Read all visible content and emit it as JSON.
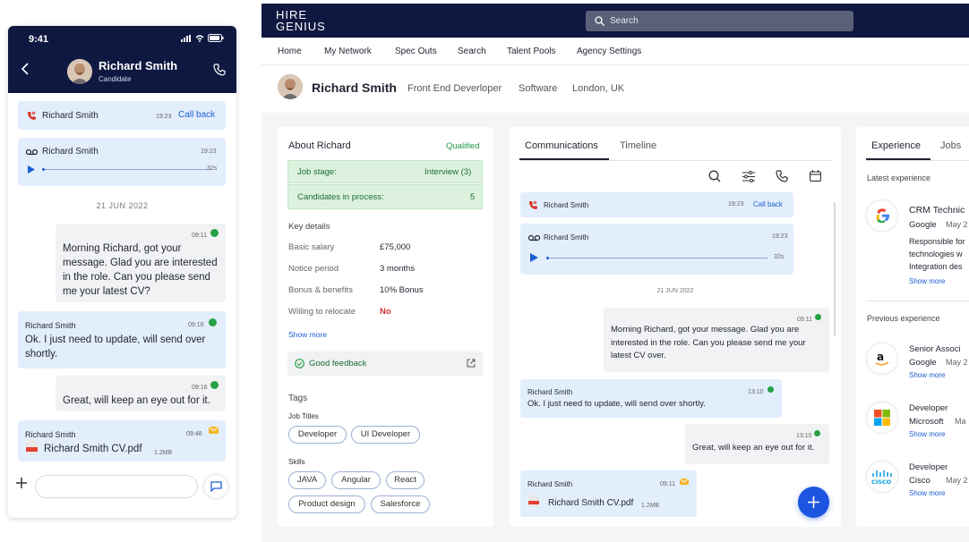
{
  "phone": {
    "status_time": "9:41",
    "contact_name": "Richard Smith",
    "contact_role": "Candidate",
    "call_card": {
      "name": "Richard Smith",
      "time": "19:23",
      "action": "Call back"
    },
    "voicemail_card": {
      "name": "Richard Smith",
      "time": "19:23",
      "duration": "32s"
    },
    "date_divider": "21 JUN 2022",
    "messages": [
      {
        "time": "09:11",
        "text": "Morning Richard, got your message. Glad you are interested in the role. Can you please send me your latest CV?"
      },
      {
        "sender": "Richard Smith",
        "time": "09:16",
        "text": "Ok. I just need to update, will send over shortly."
      },
      {
        "time": "09:16",
        "text": "Great, will keep an eye out for it."
      },
      {
        "sender": "Richard Smith",
        "time": "09:48",
        "file": "Richard Smith CV.pdf",
        "size": "1.2MB"
      }
    ]
  },
  "desktop": {
    "logo": {
      "line1": "HIRE",
      "line2": "GENIUS"
    },
    "search_placeholder": "Search",
    "nav": [
      "Home",
      "My Network",
      "Spec Outs",
      "Search",
      "Talent Pools",
      "Agency Settings"
    ],
    "profile": {
      "name": "Richard Smith",
      "title": "Front End Deverloper",
      "industry": "Software",
      "location": "London, UK"
    },
    "about": {
      "heading": "About Richard",
      "status": "Qualified",
      "job_stage_label": "Job stage:",
      "job_stage_value": "Interview (3)",
      "candidates_label": "Candidates in process:",
      "candidates_value": "5",
      "key_details_heading": "Key details",
      "details": [
        {
          "label": "Basic salary",
          "value": "£75,000"
        },
        {
          "label": "Notice period",
          "value": "3 months"
        },
        {
          "label": "Bonus & benefits",
          "value": "10% Bonus"
        },
        {
          "label": "Willing to relocate",
          "value": "No"
        }
      ],
      "show_more": "Show more",
      "feedback": "Good feedback",
      "tags_heading": "Tags",
      "job_titles_heading": "Job Titles",
      "job_titles": [
        "Developer",
        "UI Developer"
      ],
      "skills_heading": "Skills",
      "skills": [
        "JAVA",
        "Angular",
        "React",
        "Product design",
        "Salesforce"
      ]
    },
    "comms": {
      "tabs": [
        "Communications",
        "Timeline"
      ],
      "call_card": {
        "name": "Richard Smith",
        "time": "19:23",
        "action": "Call back"
      },
      "voicemail_card": {
        "name": "Richard Smith",
        "time": "19:23",
        "duration": "32s"
      },
      "date_divider": "21 JUN 2022",
      "messages": [
        {
          "time": "09:11",
          "text": "Morning Richard, got your message. Glad you are interested in the role. Can you please send me your latest CV over."
        },
        {
          "sender": "Richard Smith",
          "time": "13:10",
          "text": "Ok. I just need to update, will send over shortly."
        },
        {
          "time": "13:10",
          "text": "Great, will keep an eye out for it."
        },
        {
          "sender": "Richard Smith",
          "time": "09:11",
          "file": "Richard Smith CV.pdf",
          "size": "1.2MB"
        }
      ]
    },
    "experience": {
      "tabs": [
        "Experience",
        "Jobs"
      ],
      "latest_heading": "Latest experience",
      "latest": {
        "title": "CRM Technic",
        "company": "Google",
        "date": "May 2",
        "desc": [
          "Responsible for",
          "technologies w",
          "Integration des"
        ],
        "show_more": "Show more"
      },
      "previous_heading": "Previous experience",
      "previous": [
        {
          "title": "Senior Associ",
          "company": "Google",
          "date": "May 2",
          "show_more": "Show more"
        },
        {
          "title": "Developer",
          "company": "Microsoft",
          "date": "Ma",
          "show_more": "Show more"
        },
        {
          "title": "Developer",
          "company": "Cisco",
          "date": "May 2",
          "show_more": "Show more"
        }
      ]
    }
  }
}
